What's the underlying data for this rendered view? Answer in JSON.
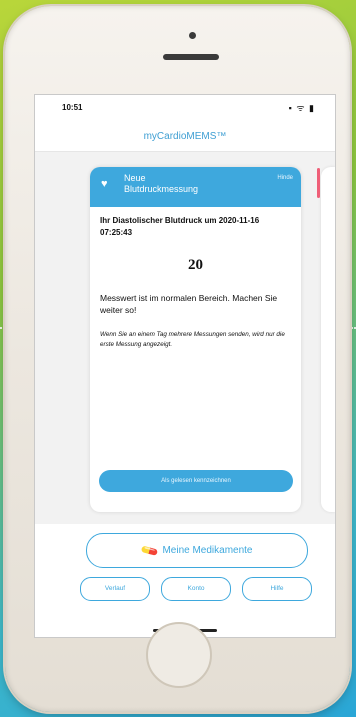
{
  "status_bar": {
    "time": "10:51",
    "icons": "▪ ᯤ ▮"
  },
  "app": {
    "title": "myCardioMEMS™"
  },
  "card": {
    "title_line1": "Neue",
    "title_line2": "Blutdruckmessung",
    "close_label": "Hinde",
    "headline": "Ihr Diastolischer Blutdruck um 2020-11-16 07:25:43",
    "value": "20",
    "message": "Messwert ist im normalen Bereich. Machen Sie weiter so!",
    "note": "Wenn Sie an einem Tag mehrere Messungen senden, wird nur die erste Messung angezeigt.",
    "ack_label": "Als gelesen kennzeichnen",
    "icon": "heart-icon"
  },
  "buttons": {
    "medications": "Meine Medikamente",
    "history": "Verlauf",
    "account": "Konto",
    "help": "Hilfe"
  },
  "colors": {
    "accent": "#3ea8dd",
    "alert_stripe": "#ef5f78"
  }
}
